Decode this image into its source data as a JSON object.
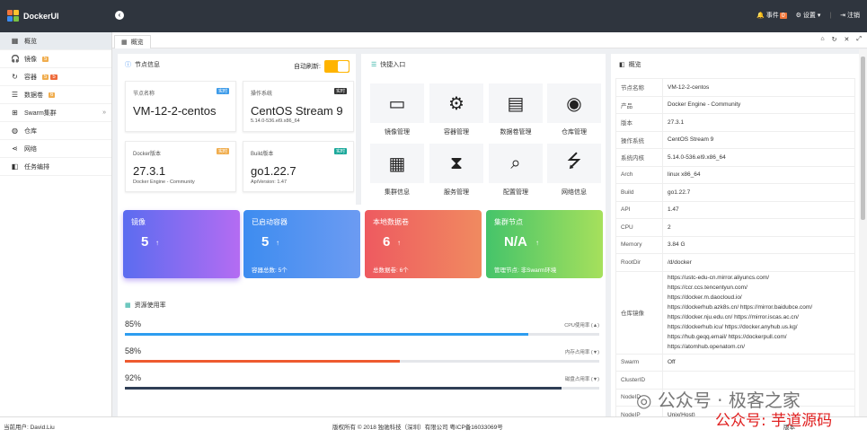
{
  "app": {
    "name": "DockerUI"
  },
  "topbar": {
    "events_label": "事件",
    "events_count": "0",
    "settings_label": "设置",
    "logout_label": "注销"
  },
  "sidebar": {
    "items": [
      {
        "label": "概览",
        "icon": "dashboard-icon"
      },
      {
        "label": "镜像",
        "badge": "5",
        "badge_color": "#f0ad4e",
        "icon": "headset-icon"
      },
      {
        "label": "容器",
        "badge": "5",
        "badge2": "5",
        "badge_color": "#f0ad4e",
        "badge2_color": "#ee6a3a",
        "icon": "refresh-icon"
      },
      {
        "label": "数据卷",
        "badge": "6",
        "badge_color": "#f0ad4e",
        "icon": "database-icon"
      },
      {
        "label": "Swarm集群",
        "icon": "sitemap-icon"
      },
      {
        "label": "仓库",
        "icon": "globe-icon"
      },
      {
        "label": "网络",
        "icon": "share-icon"
      },
      {
        "label": "任务编排",
        "icon": "layers-icon"
      }
    ]
  },
  "tabs": [
    {
      "label": "概览"
    }
  ],
  "node_info": {
    "title": "节点信息",
    "auto_refresh_label": "自动刷新:",
    "cards": [
      {
        "label": "节点名称",
        "tag": "实时",
        "value": "VM-12-2-centos",
        "sub": ""
      },
      {
        "label": "操作系统",
        "tag": "实时",
        "value": "CentOS Stream 9",
        "sub": "5.14.0-536.el9.x86_64"
      },
      {
        "label": "Docker版本",
        "tag": "实时",
        "value": "27.3.1",
        "sub": "Docker Engine - Community"
      },
      {
        "label": "Build版本",
        "tag": "实时",
        "value": "go1.22.7",
        "sub": "ApiVersion: 1.47"
      }
    ]
  },
  "quick": {
    "title": "快捷入口",
    "items": [
      {
        "label": "镜像管理",
        "icon": "window-icon"
      },
      {
        "label": "容器管理",
        "icon": "gears-icon"
      },
      {
        "label": "数据卷管理",
        "icon": "file-icon"
      },
      {
        "label": "仓库管理",
        "icon": "target-icon"
      },
      {
        "label": "集群信息",
        "icon": "calendar-icon"
      },
      {
        "label": "服务管理",
        "icon": "hourglass-icon"
      },
      {
        "label": "配置管理",
        "icon": "search-icon"
      },
      {
        "label": "网络信息",
        "icon": "usb-icon"
      }
    ]
  },
  "stats": [
    {
      "title": "镜像",
      "value": "5",
      "sub": "",
      "colors": [
        "#5b6cf0",
        "#b46cf2"
      ]
    },
    {
      "title": "已启动容器",
      "value": "5",
      "sub": "容器总数: 5个",
      "colors": [
        "#3d8cf0",
        "#6c9bf2"
      ]
    },
    {
      "title": "本地数据卷",
      "value": "6",
      "sub": "总数据卷: 6个",
      "colors": [
        "#ee5a60",
        "#f08a60"
      ]
    },
    {
      "title": "集群节点",
      "value": "N/A",
      "sub": "管理节点: 非Swarm环境",
      "colors": [
        "#45c46a",
        "#a6e05c"
      ]
    }
  ],
  "resources": {
    "title": "资源使用率",
    "rows": [
      {
        "pct": "85%",
        "label": "CPU使用率 (▲)",
        "value": 0.85,
        "color": "#2d9df0"
      },
      {
        "pct": "58%",
        "label": "内存占用率 (▼)",
        "value": 0.58,
        "color": "#ee5a2f"
      },
      {
        "pct": "92%",
        "label": "磁盘占用率 (▼)",
        "value": 0.92,
        "color": "#2f3e56"
      }
    ]
  },
  "overview": {
    "title": "概览",
    "rows": [
      {
        "k": "节点名称",
        "v": "VM-12-2-centos"
      },
      {
        "k": "产品",
        "v": "Docker Engine - Community"
      },
      {
        "k": "版本",
        "v": "27.3.1"
      },
      {
        "k": "操作系统",
        "v": "CentOS Stream 9"
      },
      {
        "k": "系统内核",
        "v": "5.14.0-536.el9.x86_64"
      },
      {
        "k": "Arch",
        "v": "linux x86_64"
      },
      {
        "k": "Build",
        "v": "go1.22.7"
      },
      {
        "k": "API",
        "v": "1.47"
      },
      {
        "k": "CPU",
        "v": "2"
      },
      {
        "k": "Memory",
        "v": "3.84 G"
      },
      {
        "k": "RootDir",
        "v": "/d/docker"
      },
      {
        "k": "仓库镜像",
        "lines": [
          "https://ustc-edu-cn.mirror.aliyuncs.com/",
          "https://ccr.ccs.tencentyun.com/",
          "https://docker.m.daocloud.io/",
          "https://dockerhub.azk8s.cn/  https://mirror.baidubce.com/",
          "https://docker.nju.edu.cn/  https://mirror.iscas.ac.cn/",
          "https://dockerhub.icu/  https://docker.anyhub.us.kg/",
          "https://hub.geqq.email/  https://dockerpull.com/",
          "https://atomhub.openatom.cn/"
        ]
      },
      {
        "k": "Swarm",
        "v": "Off"
      },
      {
        "k": "ClusterID",
        "v": ""
      },
      {
        "k": "NodeID",
        "v": ""
      },
      {
        "k": "NodeIP",
        "v": "Unix(Host)"
      }
    ]
  },
  "footer": {
    "user": "当前用户: David.Liu",
    "copyright": "版权所有 © 2018 独驰科技（深圳）有限公司 粤ICP备16033069号",
    "right": "版本"
  },
  "watermark": {
    "line1": "公众号 · 极客之家",
    "line2": "公众号: 芋道源码"
  }
}
